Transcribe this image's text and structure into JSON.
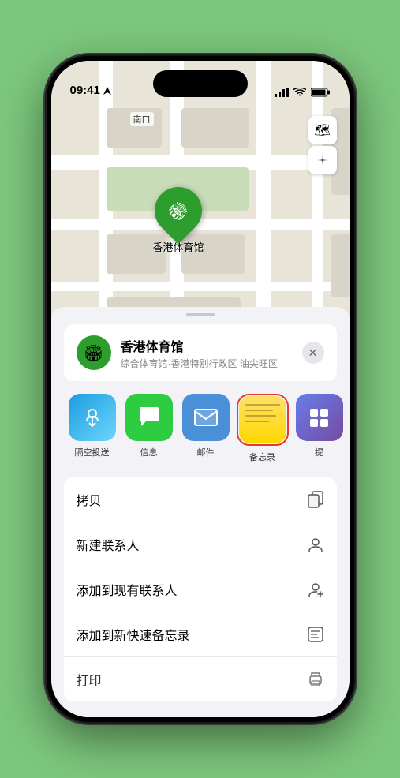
{
  "status_bar": {
    "time": "09:41",
    "location_arrow": "▲"
  },
  "map": {
    "label": "南口",
    "pin_label": "香港体育馆"
  },
  "location_header": {
    "name": "香港体育馆",
    "subtitle": "综合体育馆·香港特别行政区 油尖旺区",
    "close_label": "✕"
  },
  "share_items": [
    {
      "id": "airdrop",
      "label": "隔空投送",
      "type": "airdrop"
    },
    {
      "id": "messages",
      "label": "信息",
      "type": "messages"
    },
    {
      "id": "mail",
      "label": "邮件",
      "type": "mail"
    },
    {
      "id": "notes",
      "label": "备忘录",
      "type": "notes"
    },
    {
      "id": "more",
      "label": "提",
      "type": "more"
    }
  ],
  "actions": [
    {
      "id": "copy",
      "label": "拷贝",
      "icon": "📋"
    },
    {
      "id": "new-contact",
      "label": "新建联系人",
      "icon": "👤"
    },
    {
      "id": "add-existing",
      "label": "添加到现有联系人",
      "icon": "👤"
    },
    {
      "id": "quick-note",
      "label": "添加到新快速备忘录",
      "icon": "🗒"
    },
    {
      "id": "print",
      "label": "打印",
      "icon": "🖨"
    }
  ]
}
